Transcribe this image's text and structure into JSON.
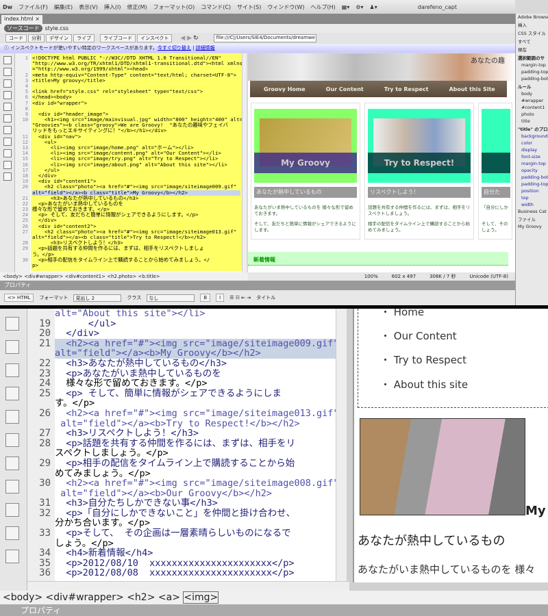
{
  "app": {
    "logo": "Dw",
    "menu": [
      "ファイル(F)",
      "編集(E)",
      "表示(V)",
      "挿入(I)",
      "修正(M)",
      "フォーマット(O)",
      "コマンド(C)",
      "サイト(S)",
      "ウィンドウ(W)",
      "ヘルプ(H)"
    ],
    "user": "darefeno_capt"
  },
  "document": {
    "tab": "index.html",
    "source_label": "ソースコード",
    "related_file": "style.css"
  },
  "toolbar": {
    "buttons": [
      "コード",
      "分割",
      "デザイン",
      "ライブ",
      "ライブコード",
      "インスペクト"
    ],
    "address": "file:///C|/Users/SIE4/Documents/dreamwe"
  },
  "infobar": {
    "message": "インスペクトモードが使いやすい特定のワークスペースがあります。",
    "link1": "今すぐ切り替え",
    "link2": "詳細情報"
  },
  "top_code": {
    "lines": [
      "<!DOCTYPE html PUBLIC \"-//W3C//DTD XHTML 1.0 Transitional//EN\"",
      "\"http://www.w3.org/TR/xhtml1/DTD/xhtml1-transitional.dtd\"><html xmlns",
      "=\"http://www.w3.org/1999/xhtml\"><head>",
      "<meta http-equiv=\"Content-Type\" content=\"text/html; charset=UTF-8\">",
      "<title>My groovy</title>",
      "",
      "<link href=\"style.css\" rel=\"stylesheet\" type=\"text/css\">",
      "</head><body>",
      "<div id=\"wrapper\">",
      "",
      "  <div id=\"header_image\">",
      "    <h1><img src=\"image/mainvisual.jpg\" width=\"800\" height=\"400\" alt=",
      "\"Groovies\"><b class=\"groovy\">We are Groovy!  \"あなたの趣味やフェイバ",
      "リッドをもっとエキサイティングに！\"</b></h1></div>",
      "  <div id=\"nav\">",
      "    <ul>",
      "      <li><img src=\"image/home.png\" alt=\"ホーム\"></li>",
      "      <li><img src=\"image/content.png\" alt=\"Our Content\"></li>",
      "      <li><img src=\"image/try.png\" alt=\"Try to Respect\"></li>",
      "      <li><img src=\"image/about.png\" alt=\"About this site\"></li>",
      "    </ul>",
      "  </div>",
      "  <div id=\"content1\">",
      "    <h2 class=\"photo\"><a href=\"#\"><img src=\"image/siteimage009.gif\"",
      "alt=\"field\"></a><b class=\"title\">My Groovy</b></h2>",
      "      <h3>あなたが熱中しているもの</h3>",
      "  <p>あなたがいま熱中しているものを",
      "様々な形で留めておきます。</p>",
      "  <p> そして、友だちと簡単に情報がシェアできるようにします。</p>",
      "  </div>",
      "  <div id=\"content2\">",
      "    <h2 class=\"photo\"><a href=\"#\"><img src=\"image/siteimage013.gif\"",
      "alt=\"field\"></a><b class=\"title\">Try to Respect!</b></h2>",
      "      <h3>リスペクトしよう！</h3>",
      "  <p>話題を共有する仲間を作るには、まずは、相手をリスペクトしましょ",
      "う。</p>",
      "  <p>相手の配信をタイムライン上で購読することから始めてみましょう。</",
      "p>"
    ],
    "line_numbers": [
      "1",
      "",
      "",
      "2",
      "3",
      "4",
      "5",
      "6",
      "7",
      "8",
      "9",
      "10",
      "",
      "",
      "11",
      "12",
      "13",
      "14",
      "15",
      "16",
      "17",
      "18",
      "19",
      "20",
      "",
      "21",
      "22",
      "23",
      "24",
      "25",
      "26",
      "27",
      "",
      "28",
      "29",
      "",
      "30",
      ""
    ]
  },
  "design_view": {
    "header_text": "あなたの趣",
    "nav": [
      "Groovy Home",
      "Our Content",
      "Try to Respect",
      "About this Site"
    ],
    "cards": [
      {
        "caption": "My Groovy",
        "heading": "あなたが熱中しているもの",
        "p1": "あなたがいま熱中しているものを 様々な形で留めておきます。",
        "p2": "そして、友だちと簡単に情報がシェアできるようにします。"
      },
      {
        "caption": "Try to Respect!",
        "heading": "リスペクトしよう！",
        "p1": "話題を共有する仲間を作るには、まずは、相手をリスペクトしましょう。",
        "p2": "相手の配信をタイムライン上で購読することから始めてみましょう。"
      },
      {
        "caption": "",
        "heading": "自分た",
        "p1": "「自分にしか",
        "p2": "そして、その しょう。"
      }
    ],
    "news": "新着情報"
  },
  "status": {
    "tag_selector": "<body> <div#wrapper> <div#content1> <h2.photo> <b.title>",
    "zoom": "100%",
    "size": "602 x 497",
    "download": "306K / 7 秒",
    "encoding": "Unicode (UTF-8)"
  },
  "properties": {
    "title": "プロパティ",
    "html_btn": "<> HTML",
    "format_label": "フォーマット",
    "format_value": "見出し 2",
    "class_label": "クラス",
    "class_value": "なし",
    "bold": "B",
    "italic": "I",
    "title_label": "タイトル"
  },
  "right_panel": {
    "items": [
      "Adobe Browse",
      "挿入",
      "CSS スタイル",
      "すべて",
      "現在",
      "選択範囲のサ",
      "margin-top",
      "padding-top",
      "padding-bot",
      "ルール",
      "body",
      "#wrapper",
      "#content1",
      "photo",
      "title",
      "\"title\" のプロ",
      "background",
      "color",
      "display",
      "font-size",
      "margin-top",
      "opacity",
      "padding-bot",
      "padding-top",
      "position",
      "top",
      "width",
      "Business Cat",
      "ファイル",
      "My Groovy"
    ]
  },
  "bottom_code": {
    "line_numbers": [
      "",
      "19",
      "20",
      "21",
      "",
      "22",
      "23",
      "24",
      "25",
      "",
      "26",
      "",
      "27",
      "28",
      "",
      "29",
      "",
      "30",
      "",
      "31",
      "32",
      "",
      "33",
      "",
      "34",
      "35",
      "36"
    ],
    "lines": [
      "alt=\"About this site\"></li>",
      "      </ul>",
      "  </div>",
      "  <h2><a href=\"#\"><img src=\"image/siteimage009.gif\"",
      "alt=\"field\"></a><b>My Groovy</b></h2>",
      "  <h3>あなたが熱中しているもの</h3>",
      "  <p>あなたがいま熱中しているものを",
      "  様々な形で留めておきます。</p>",
      "  <p> そして、簡単に情報がシェアできるようにしま",
      "す。</p>",
      "  <h2><a href=\"#\"><img src=\"image/siteimage013.gif\"",
      " alt=\"field\"></a><b>Try to Respect!</b></h2>",
      "  <h3>リスペクトしよう！</h3>",
      "  <p>話題を共有する仲間を作るには、まずは、相手をリ",
      "スペクトしましょう。</p>",
      "  <p>相手の配信をタイムライン上で購読することから始",
      "めてみましょう。</p>",
      "  <h2><a href=\"#\"><img src=\"image/siteimage008.gif\"",
      " alt=\"field\"></a><b>Our Groovy</b></h2>",
      "  <h3>自分たちしかできない事</h3>",
      "  <p>「自分にしかできないこと」を仲間と掛け合わせ、",
      "分かち合います。</p>",
      "  <p>そして、 その企画は一層素晴らしいものになるで",
      "しょう。</p>",
      "  <h4>新着情報</h4>",
      "  <p>2012/08/10  xxxxxxxxxxxxxxxxxxxxxx</p>",
      "  <p>2012/08/08  xxxxxxxxxxxxxxxxxxxxxx</p>"
    ]
  },
  "bottom_design": {
    "nav": [
      "Home",
      "Our Content",
      "Try to Respect",
      "About this site"
    ],
    "h2": "My",
    "h3": "あなたが熱中しているもの",
    "p": "あなたがいま熱中しているものを 様々"
  },
  "bottom_status": {
    "tags": [
      "<body>",
      "<div#wrapper>",
      "<h2>",
      "<a>"
    ],
    "current": "<img>",
    "properties": "プロパティ"
  }
}
